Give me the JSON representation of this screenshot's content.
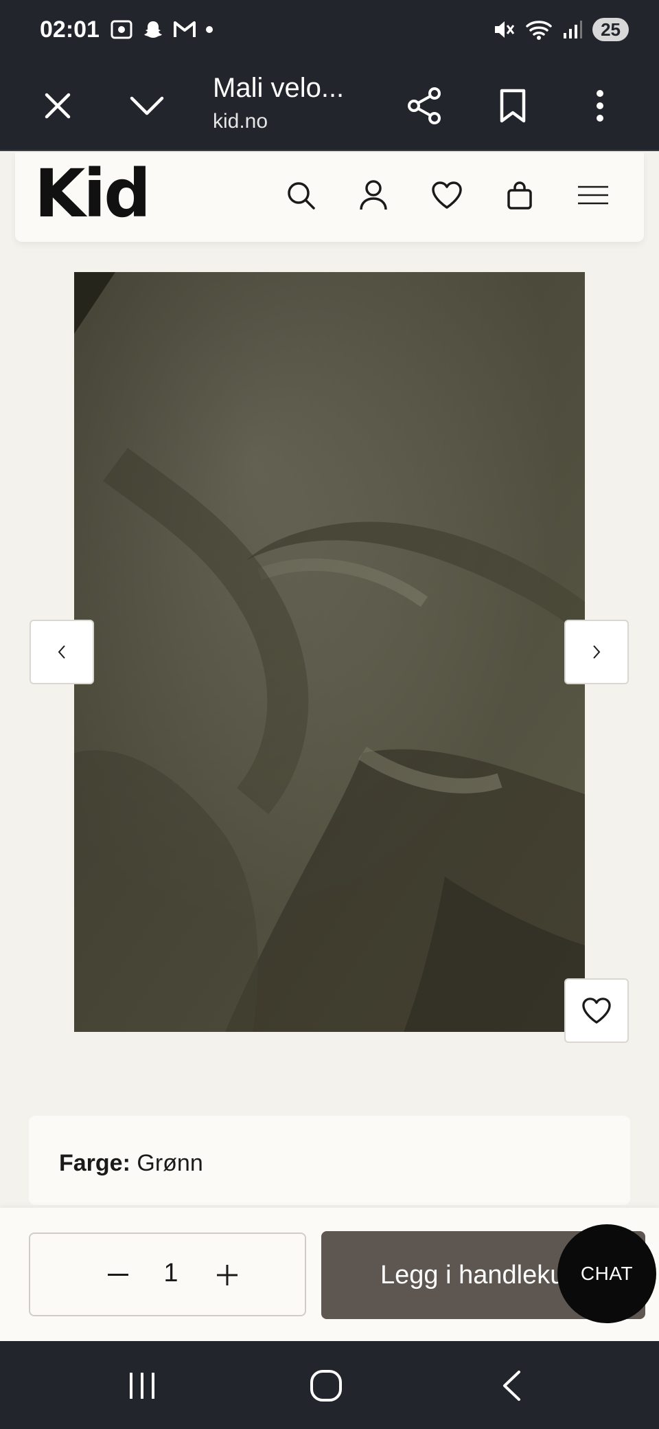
{
  "status_bar": {
    "time": "02:01",
    "battery": "25"
  },
  "browser": {
    "title": "Mali velo...",
    "url": "kid.no"
  },
  "site": {
    "logo": "Kid"
  },
  "product": {
    "color_label": "Farge:",
    "color_value": "Grønn"
  },
  "cart": {
    "quantity": "1",
    "add_label": "Legg i handlekurv",
    "chat_label": "CHAT"
  },
  "colors": {
    "system_bar": "#23252c",
    "page_bg": "#f4f2ed",
    "card_bg": "#fbfaf6",
    "cart_button": "#5e5751",
    "chat_button": "#0a0a0a",
    "fabric": "#5f5d4d"
  }
}
